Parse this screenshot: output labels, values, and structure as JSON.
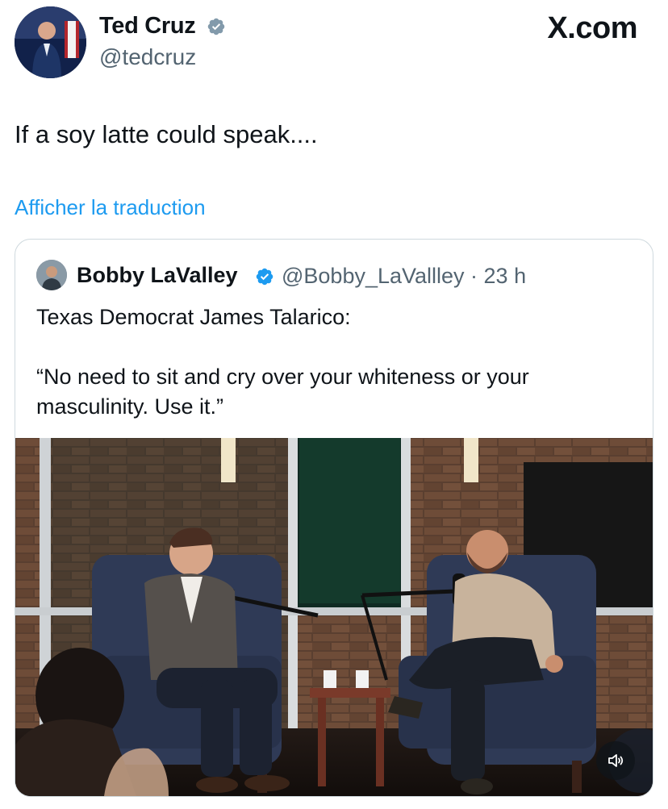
{
  "author": {
    "name": "Ted Cruz",
    "handle": "@tedcruz"
  },
  "brand": "X.com",
  "tweet": {
    "text": "If a soy latte could speak....",
    "translate_label": "Afficher la traduction"
  },
  "quote": {
    "author_name": "Bobby LaValley",
    "meta": "@Bobby_LaVallley · 23 h",
    "text_line1": "Texas Democrat James Talarico:",
    "text_line2": "“No need to sit and cry over your whiteness or your masculinity. Use it.”"
  },
  "icons": {
    "verified": "verified-badge-icon",
    "sound": "speaker-icon"
  },
  "colors": {
    "link": "#1d9bf0",
    "secondary_text": "#536471",
    "verified": "#829aab"
  }
}
